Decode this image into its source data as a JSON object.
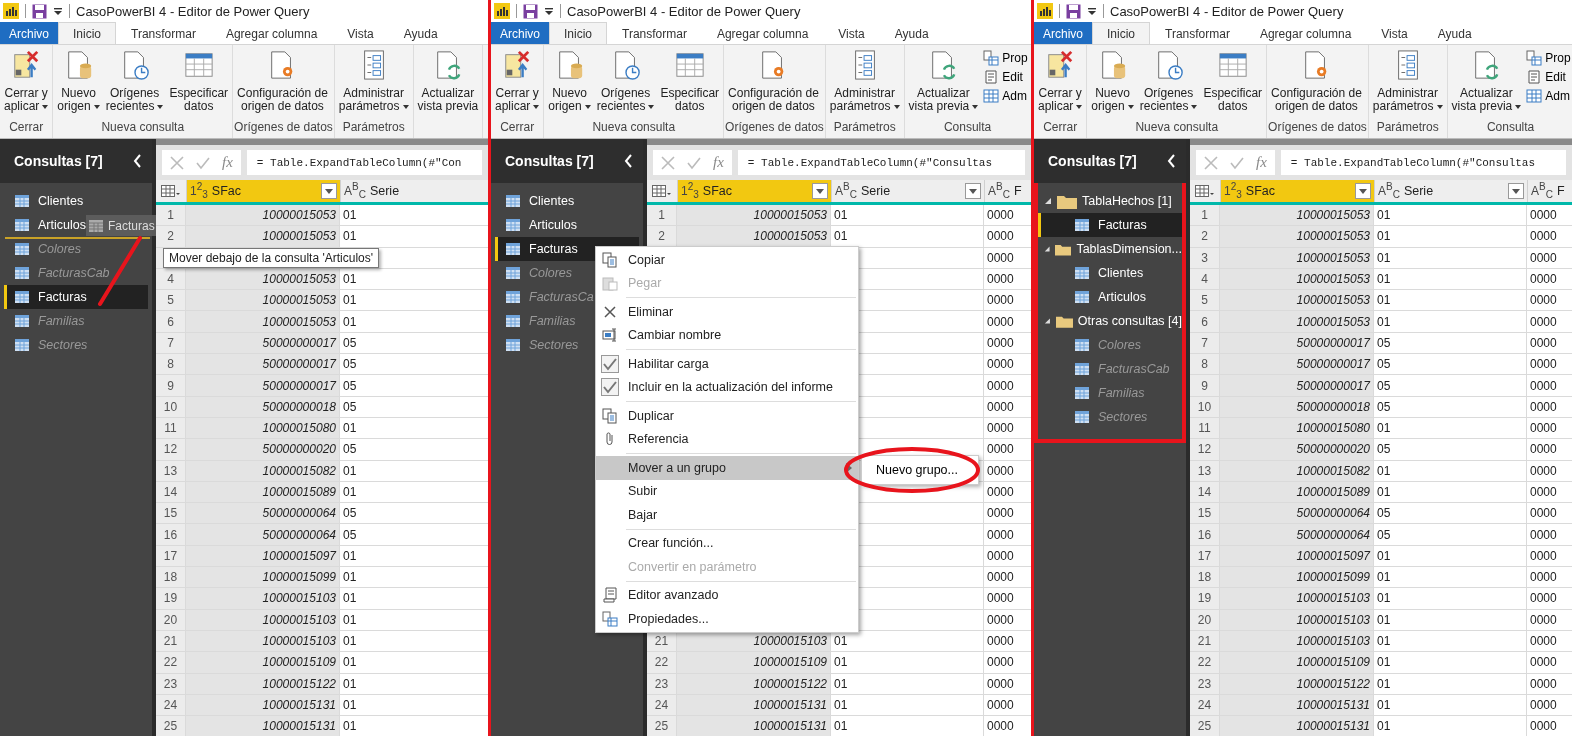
{
  "panels": [
    {
      "title": "CasoPowerBI 4 - Editor de Power Query",
      "tabs": [
        {
          "label": "Archivo",
          "kind": "file",
          "selected": false
        },
        {
          "label": "Inicio",
          "kind": "tab",
          "selected": true
        },
        {
          "label": "Transformar",
          "kind": "tab",
          "selected": false
        },
        {
          "label": "Agregar columna",
          "kind": "tab",
          "selected": false
        },
        {
          "label": "Vista",
          "kind": "tab",
          "selected": false
        },
        {
          "label": "Ayuda",
          "kind": "tab",
          "selected": false
        }
      ],
      "ribbon": [
        {
          "label": "Cerrar",
          "buttons": [
            {
              "label": "Cerrar y\naplicar",
              "dropdown": true
            }
          ]
        },
        {
          "label": "Nueva consulta",
          "buttons": [
            {
              "label": "Nuevo\norigen",
              "dropdown": true
            },
            {
              "label": "Orígenes\nrecientes",
              "dropdown": true
            },
            {
              "label": "Especificar\ndatos",
              "dropdown": false
            }
          ]
        },
        {
          "label": "Orígenes de datos",
          "buttons": [
            {
              "label": "Configuración de\norigen de datos",
              "dropdown": false
            }
          ]
        },
        {
          "label": "Parámetros",
          "buttons": [
            {
              "label": "Administrar\nparámetros",
              "dropdown": true
            }
          ]
        },
        {
          "buttons": [
            {
              "label": "Actualizar\nvista previa",
              "dropdown": false
            }
          ]
        }
      ],
      "sidebar": {
        "title": "Consultas [7]",
        "highlighted": false,
        "items": [
          {
            "kind": "query",
            "label": "Clientes",
            "loaded": true,
            "selected": false
          },
          {
            "kind": "query",
            "label": "Articulos",
            "loaded": true,
            "selected": false
          },
          {
            "kind": "query",
            "label": "Colores",
            "loaded": false,
            "selected": false
          },
          {
            "kind": "query",
            "label": "FacturasCab",
            "loaded": false,
            "selected": false
          },
          {
            "kind": "query",
            "label": "Facturas",
            "loaded": true,
            "selected": true
          },
          {
            "kind": "query",
            "label": "Familias",
            "loaded": false,
            "selected": false
          },
          {
            "kind": "query",
            "label": "Sectores",
            "loaded": false,
            "selected": false
          }
        ]
      },
      "formula": {
        "fx": "fx",
        "text": "= Table.ExpandTableColumn(#\"Con"
      },
      "table": {
        "columns": [
          {
            "type": "1$^{2}$$_{3}$",
            "label": "SFac",
            "filter": true,
            "selected": true
          },
          {
            "type": "A$^{B}$$_{C}$",
            "label": "Serie",
            "filter": false,
            "selected": false
          }
        ],
        "rows": [
          {
            "n": "1",
            "sfac": "10000015053",
            "serie": "01"
          },
          {
            "n": "2",
            "sfac": "10000015053",
            "serie": "01"
          },
          {},
          {
            "n": "4",
            "sfac": "10000015053",
            "serie": "01"
          },
          {
            "n": "5",
            "sfac": "10000015053",
            "serie": "01"
          },
          {
            "n": "6",
            "sfac": "10000015053",
            "serie": "01"
          },
          {
            "n": "7",
            "sfac": "50000000017",
            "serie": "05"
          },
          {
            "n": "8",
            "sfac": "50000000017",
            "serie": "05"
          },
          {
            "n": "9",
            "sfac": "50000000017",
            "serie": "05"
          },
          {
            "n": "10",
            "sfac": "50000000018",
            "serie": "05"
          },
          {
            "n": "11",
            "sfac": "10000015080",
            "serie": "01"
          },
          {
            "n": "12",
            "sfac": "50000000020",
            "serie": "05"
          },
          {
            "n": "13",
            "sfac": "10000015082",
            "serie": "01"
          },
          {
            "n": "14",
            "sfac": "10000015089",
            "serie": "01"
          },
          {
            "n": "15",
            "sfac": "50000000064",
            "serie": "05"
          },
          {
            "n": "16",
            "sfac": "50000000064",
            "serie": "05"
          },
          {
            "n": "17",
            "sfac": "10000015097",
            "serie": "01"
          },
          {
            "n": "18",
            "sfac": "10000015099",
            "serie": "01"
          },
          {
            "n": "19",
            "sfac": "10000015103",
            "serie": "01"
          },
          {
            "n": "20",
            "sfac": "10000015103",
            "serie": "01"
          },
          {
            "n": "21",
            "sfac": "10000015103",
            "serie": "01"
          },
          {
            "n": "22",
            "sfac": "10000015109",
            "serie": "01"
          },
          {
            "n": "23",
            "sfac": "10000015122",
            "serie": "01"
          },
          {
            "n": "24",
            "sfac": "10000015131",
            "serie": "01"
          },
          {
            "n": "25",
            "sfac": "10000015131",
            "serie": "01"
          }
        ]
      },
      "drag": {
        "label": "Facturas",
        "tooltip": "Mover debajo de la consulta 'Articulos'"
      }
    },
    {
      "title": "CasoPowerBI 4 - Editor de Power Query",
      "tabs": [
        {
          "label": "Archivo",
          "kind": "file",
          "selected": false
        },
        {
          "label": "Inicio",
          "kind": "tab",
          "selected": true
        },
        {
          "label": "Transformar",
          "kind": "tab",
          "selected": false
        },
        {
          "label": "Agregar columna",
          "kind": "tab",
          "selected": false
        },
        {
          "label": "Vista",
          "kind": "tab",
          "selected": false
        },
        {
          "label": "Ayuda",
          "kind": "tab",
          "selected": false
        }
      ],
      "ribbon": [
        {
          "label": "Cerrar",
          "buttons": [
            {
              "label": "Cerrar y\naplicar",
              "dropdown": true
            }
          ]
        },
        {
          "label": "Nueva consulta",
          "buttons": [
            {
              "label": "Nuevo\norigen",
              "dropdown": true
            },
            {
              "label": "Orígenes\nrecientes",
              "dropdown": true
            },
            {
              "label": "Especificar\ndatos",
              "dropdown": false
            }
          ]
        },
        {
          "label": "Orígenes de datos",
          "buttons": [
            {
              "label": "Configuración de\norigen de datos",
              "dropdown": false
            }
          ]
        },
        {
          "label": "Parámetros",
          "buttons": [
            {
              "label": "Administrar\nparámetros",
              "dropdown": true
            }
          ]
        },
        {
          "label": "Consulta",
          "buttons": [
            {
              "label": "Actualizar\nvista previa",
              "dropdown": true
            }
          ],
          "small": [
            {
              "label": "Prop"
            },
            {
              "label": "Edit"
            },
            {
              "label": "Adm"
            }
          ]
        }
      ],
      "sidebar": {
        "title": "Consultas [7]",
        "highlighted": false,
        "items": [
          {
            "kind": "query",
            "label": "Clientes",
            "loaded": true,
            "selected": false
          },
          {
            "kind": "query",
            "label": "Articulos",
            "loaded": true,
            "selected": false
          },
          {
            "kind": "query",
            "label": "Facturas",
            "loaded": true,
            "selected": true
          },
          {
            "kind": "query",
            "label": "Colores",
            "loaded": false,
            "selected": false
          },
          {
            "kind": "query",
            "label": "FacturasCa",
            "loaded": false,
            "selected": false
          },
          {
            "kind": "query",
            "label": "Familias",
            "loaded": false,
            "selected": false
          },
          {
            "kind": "query",
            "label": "Sectores",
            "loaded": false,
            "selected": false
          }
        ]
      },
      "formula": {
        "fx": "fx",
        "text": "= Table.ExpandTableColumn(#\"Consultas"
      },
      "table": {
        "columns": [
          {
            "type": "1$^{2}$$_{3}$",
            "label": "SFac",
            "filter": true,
            "selected": true
          },
          {
            "type": "A$^{B}$$_{C}$",
            "label": "Serie",
            "filter": true,
            "selected": false
          },
          {
            "type": "A$^{B}$$_{C}$",
            "label": "F",
            "filter": false,
            "selected": false
          }
        ],
        "rows": [
          {
            "n": "1",
            "sfac": "10000015053",
            "serie": "01",
            "column_3": "0000"
          },
          {
            "n": "2",
            "sfac": "10000015053",
            "serie": "01",
            "column_3": "0000"
          },
          {
            "column_3": "0000"
          },
          {
            "column_3": "0000"
          },
          {
            "column_3": "0000"
          },
          {
            "column_3": "0000"
          },
          {
            "column_3": "0000"
          },
          {
            "column_3": "0000"
          },
          {
            "column_3": "0000"
          },
          {
            "column_3": "0000"
          },
          {
            "column_3": "0000"
          },
          {
            "column_3": "0000"
          },
          {
            "column_3": "0000"
          },
          {
            "column_3": "0000"
          },
          {
            "column_3": "0000"
          },
          {
            "column_3": "0000"
          },
          {
            "column_3": "0000"
          },
          {
            "column_3": "0000"
          },
          {
            "column_3": "0000"
          },
          {
            "column_3": "0000"
          },
          {
            "n": "21",
            "sfac": "10000015103",
            "serie": "01",
            "column_3": "0000"
          },
          {
            "n": "22",
            "sfac": "10000015109",
            "serie": "01",
            "column_3": "0000"
          },
          {
            "n": "23",
            "sfac": "10000015122",
            "serie": "01",
            "column_3": "0000"
          },
          {
            "n": "24",
            "sfac": "10000015131",
            "serie": "01",
            "column_3": "0000"
          },
          {
            "n": "25",
            "sfac": "10000015131",
            "serie": "01",
            "column_3": "0000"
          }
        ]
      },
      "context_menu": {
        "items": [
          {
            "kind": "item",
            "label": "Copiar",
            "disabled": false
          },
          {
            "kind": "item",
            "label": "Pegar",
            "disabled": true
          },
          {
            "kind": "separator"
          },
          {
            "kind": "item",
            "label": "Eliminar",
            "disabled": false
          },
          {
            "kind": "item",
            "label": "Cambiar nombre",
            "disabled": false
          },
          {
            "kind": "separator"
          },
          {
            "kind": "check",
            "label": "Habilitar carga",
            "checked": true,
            "disabled": false
          },
          {
            "kind": "check",
            "label": "Incluir en la actualización del informe",
            "checked": true,
            "disabled": false
          },
          {
            "kind": "separator"
          },
          {
            "kind": "item",
            "label": "Duplicar",
            "disabled": false
          },
          {
            "kind": "item",
            "label": "Referencia",
            "disabled": false
          },
          {
            "kind": "separator"
          },
          {
            "kind": "submenu",
            "label": "Mover a un grupo",
            "highlighted": true,
            "disabled": false
          },
          {
            "kind": "item",
            "label": "Subir",
            "disabled": false
          },
          {
            "kind": "item",
            "label": "Bajar",
            "disabled": false
          },
          {
            "kind": "separator"
          },
          {
            "kind": "item",
            "label": "Crear función...",
            "disabled": false
          },
          {
            "kind": "item",
            "label": "Convertir en parámetro",
            "disabled": true
          },
          {
            "kind": "separator"
          },
          {
            "kind": "item",
            "label": "Editor avanzado",
            "disabled": false
          },
          {
            "kind": "item",
            "label": "Propiedades...",
            "disabled": false
          }
        ],
        "submenu": {
          "label": "Nuevo grupo..."
        }
      }
    },
    {
      "title": "CasoPowerBI 4 - Editor de Power Query",
      "tabs": [
        {
          "label": "Archivo",
          "kind": "file",
          "selected": false
        },
        {
          "label": "Inicio",
          "kind": "tab",
          "selected": true
        },
        {
          "label": "Transformar",
          "kind": "tab",
          "selected": false
        },
        {
          "label": "Agregar columna",
          "kind": "tab",
          "selected": false
        },
        {
          "label": "Vista",
          "kind": "tab",
          "selected": false
        },
        {
          "label": "Ayuda",
          "kind": "tab",
          "selected": false
        }
      ],
      "ribbon": [
        {
          "label": "Cerrar",
          "buttons": [
            {
              "label": "Cerrar y\naplicar",
              "dropdown": true
            }
          ]
        },
        {
          "label": "Nueva consulta",
          "buttons": [
            {
              "label": "Nuevo\norigen",
              "dropdown": true
            },
            {
              "label": "Orígenes\nrecientes",
              "dropdown": true
            },
            {
              "label": "Especificar\ndatos",
              "dropdown": false
            }
          ]
        },
        {
          "label": "Orígenes de datos",
          "buttons": [
            {
              "label": "Configuración de\norigen de datos",
              "dropdown": false
            }
          ]
        },
        {
          "label": "Parámetros",
          "buttons": [
            {
              "label": "Administrar\nparámetros",
              "dropdown": true
            }
          ]
        },
        {
          "label": "Consulta",
          "buttons": [
            {
              "label": "Actualizar\nvista previa",
              "dropdown": true
            }
          ],
          "small": [
            {
              "label": "Prop"
            },
            {
              "label": "Edit"
            },
            {
              "label": "Adm"
            }
          ]
        }
      ],
      "sidebar": {
        "title": "Consultas [7]",
        "highlighted": true,
        "items": [
          {
            "kind": "group",
            "label": "TablaHechos [1]",
            "expanded": true,
            "children": [
              {
                "kind": "query",
                "label": "Facturas",
                "loaded": true,
                "selected": true
              }
            ]
          },
          {
            "kind": "group",
            "label": "TablasDimension...",
            "expanded": true,
            "children": [
              {
                "kind": "query",
                "label": "Clientes",
                "loaded": true,
                "selected": false
              },
              {
                "kind": "query",
                "label": "Articulos",
                "loaded": true,
                "selected": false
              }
            ]
          },
          {
            "kind": "group",
            "label": "Otras consultas [4]",
            "expanded": true,
            "children": [
              {
                "kind": "query",
                "label": "Colores",
                "loaded": false,
                "selected": false
              },
              {
                "kind": "query",
                "label": "FacturasCab",
                "loaded": false,
                "selected": false
              },
              {
                "kind": "query",
                "label": "Familias",
                "loaded": false,
                "selected": false
              },
              {
                "kind": "query",
                "label": "Sectores",
                "loaded": false,
                "selected": false
              }
            ]
          }
        ]
      },
      "formula": {
        "fx": "fx",
        "text": "= Table.ExpandTableColumn(#\"Consultas"
      },
      "table": {
        "columns": [
          {
            "type": "1$^{2}$$_{3}$",
            "label": "SFac",
            "filter": true,
            "selected": true
          },
          {
            "type": "A$^{B}$$_{C}$",
            "label": "Serie",
            "filter": true,
            "selected": false
          },
          {
            "type": "A$^{B}$$_{C}$",
            "label": "F",
            "filter": false,
            "selected": false
          }
        ],
        "rows": [
          {
            "n": "1",
            "sfac": "10000015053",
            "serie": "01",
            "column_3": "0000"
          },
          {
            "n": "2",
            "sfac": "10000015053",
            "serie": "01",
            "column_3": "0000"
          },
          {
            "n": "3",
            "sfac": "10000015053",
            "serie": "01",
            "column_3": "0000"
          },
          {
            "n": "4",
            "sfac": "10000015053",
            "serie": "01",
            "column_3": "0000"
          },
          {
            "n": "5",
            "sfac": "10000015053",
            "serie": "01",
            "column_3": "0000"
          },
          {
            "n": "6",
            "sfac": "10000015053",
            "serie": "01",
            "column_3": "0000"
          },
          {
            "n": "7",
            "sfac": "50000000017",
            "serie": "05",
            "column_3": "0000"
          },
          {
            "n": "8",
            "sfac": "50000000017",
            "serie": "05",
            "column_3": "0000"
          },
          {
            "n": "9",
            "sfac": "50000000017",
            "serie": "05",
            "column_3": "0000"
          },
          {
            "n": "10",
            "sfac": "50000000018",
            "serie": "05",
            "column_3": "0000"
          },
          {
            "n": "11",
            "sfac": "10000015080",
            "serie": "01",
            "column_3": "0000"
          },
          {
            "n": "12",
            "sfac": "50000000020",
            "serie": "05",
            "column_3": "0000"
          },
          {
            "n": "13",
            "sfac": "10000015082",
            "serie": "01",
            "column_3": "0000"
          },
          {
            "n": "14",
            "sfac": "10000015089",
            "serie": "01",
            "column_3": "0000"
          },
          {
            "n": "15",
            "sfac": "50000000064",
            "serie": "05",
            "column_3": "0000"
          },
          {
            "n": "16",
            "sfac": "50000000064",
            "serie": "05",
            "column_3": "0000"
          },
          {
            "n": "17",
            "sfac": "10000015097",
            "serie": "01",
            "column_3": "0000"
          },
          {
            "n": "18",
            "sfac": "10000015099",
            "serie": "01",
            "column_3": "0000"
          },
          {
            "n": "19",
            "sfac": "10000015103",
            "serie": "01",
            "column_3": "0000"
          },
          {
            "n": "20",
            "sfac": "10000015103",
            "serie": "01",
            "column_3": "0000"
          },
          {
            "n": "21",
            "sfac": "10000015103",
            "serie": "01",
            "column_3": "0000"
          },
          {
            "n": "22",
            "sfac": "10000015109",
            "serie": "01",
            "column_3": "0000"
          },
          {
            "n": "23",
            "sfac": "10000015122",
            "serie": "01",
            "column_3": "0000"
          },
          {
            "n": "24",
            "sfac": "10000015131",
            "serie": "01",
            "column_3": "0000"
          },
          {
            "n": "25",
            "sfac": "10000015131",
            "serie": "01",
            "column_3": "0000"
          }
        ]
      }
    }
  ]
}
